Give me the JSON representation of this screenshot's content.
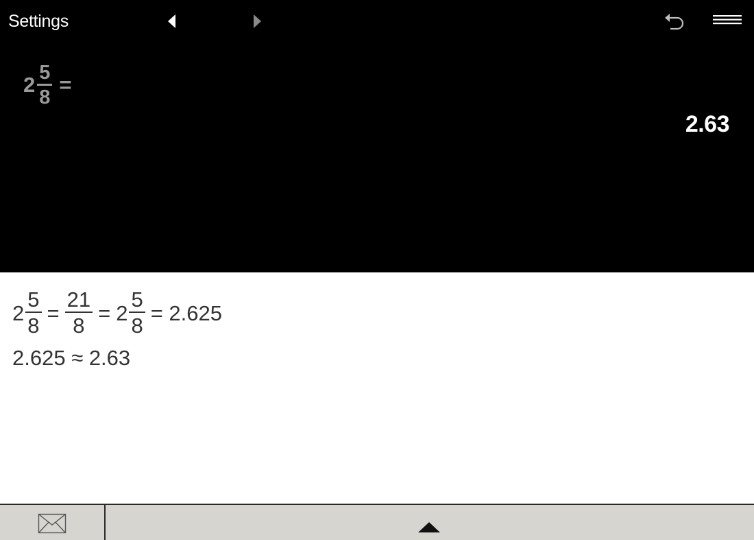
{
  "toolbar": {
    "settings_label": "Settings",
    "prev_icon": "triangle-left-icon",
    "next_icon": "triangle-right-icon",
    "undo_icon": "undo-icon",
    "menu_icon": "hamburger-menu-icon"
  },
  "display": {
    "expression": {
      "whole": "2",
      "numerator": "5",
      "denominator": "8",
      "equals": "="
    },
    "result": "2.63"
  },
  "steps": {
    "line1": {
      "term1": {
        "whole": "2",
        "numerator": "5",
        "denominator": "8"
      },
      "eq1": "=",
      "term2": {
        "numerator": "21",
        "denominator": "8"
      },
      "eq2": "=",
      "term3": {
        "whole": "2",
        "numerator": "5",
        "denominator": "8"
      },
      "eq3": "= 2.625"
    },
    "line2": "2.625 ≈ 2.63"
  },
  "bottombar": {
    "mail_icon": "envelope-icon",
    "expand_icon": "triangle-up-icon"
  },
  "colors": {
    "display_bg": "#000000",
    "expression_text": "#9a9a9a",
    "result_text": "#ffffff",
    "steps_text": "#333333",
    "bottombar_bg": "#d6d5d0"
  }
}
